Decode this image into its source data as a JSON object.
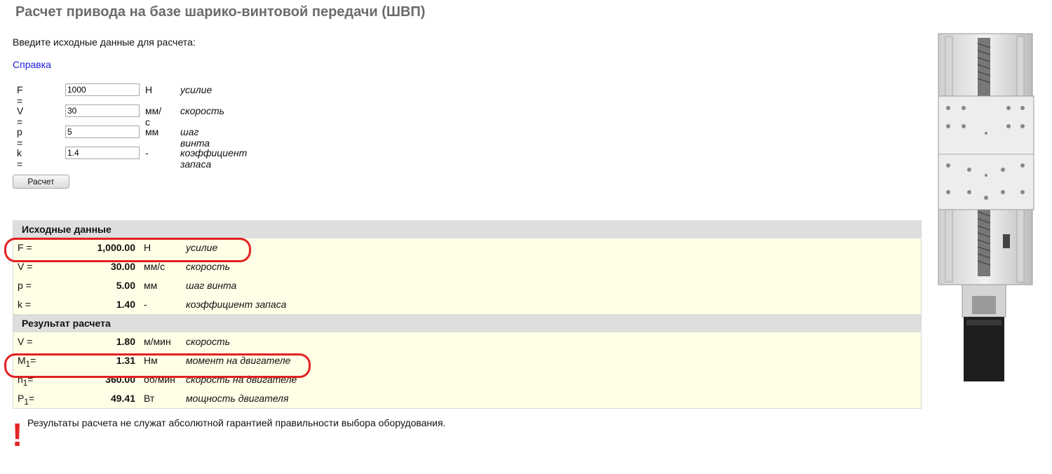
{
  "page": {
    "title": "Расчет привода на базе шарико-винтовой передачи (ШВП)",
    "intro": "Введите исходные данные для расчета:",
    "help_link": "Справка"
  },
  "inputs": [
    {
      "label": "F =",
      "value": "1000",
      "unit": "Н",
      "desc": "усилие"
    },
    {
      "label": "V =",
      "value": "30",
      "unit": "мм/с",
      "desc": "скорость"
    },
    {
      "label": "p =",
      "value": "5",
      "unit": "мм",
      "desc": "шаг винта"
    },
    {
      "label": "k =",
      "value": "1.4",
      "unit": "-",
      "desc": "коэффициент запаса"
    }
  ],
  "calc_button": "Расчет",
  "source_section": {
    "title": "Исходные данные",
    "rows": [
      {
        "label": "F =",
        "value": "1,000.00",
        "unit": "Н",
        "desc": "усилие"
      },
      {
        "label": "V =",
        "value": "30.00",
        "unit": "мм/с",
        "desc": "скорость"
      },
      {
        "label": "p =",
        "value": "5.00",
        "unit": "мм",
        "desc": "шаг винта"
      },
      {
        "label": "k =",
        "value": "1.40",
        "unit": "-",
        "desc": "коэффициент запаса"
      }
    ]
  },
  "result_section": {
    "title": "Результат расчета",
    "rows": [
      {
        "label": "V =",
        "value": "1.80",
        "unit": "м/мин",
        "desc": "скорость"
      },
      {
        "label": "M",
        "sub": "1",
        "eq": "=",
        "value": "1.31",
        "unit": "Нм",
        "desc": "момент на двигателе"
      },
      {
        "label": "n",
        "sub": "1",
        "eq": "=",
        "value": "360.00",
        "unit": "об/мин",
        "desc": "скорость на двигателе"
      },
      {
        "label": "P",
        "sub": "1",
        "eq": "=",
        "value": "49.41",
        "unit": "Вт",
        "desc": "мощность двигателя"
      }
    ]
  },
  "disclaimer": {
    "mark": "!",
    "text": "Результаты расчета не служат абсолютной гарантией правильности выбора оборудования."
  },
  "colors": {
    "highlight": "#e42020",
    "row_bg": "#fffee6",
    "section_bg": "#dedede",
    "link": "#1a1adb"
  }
}
